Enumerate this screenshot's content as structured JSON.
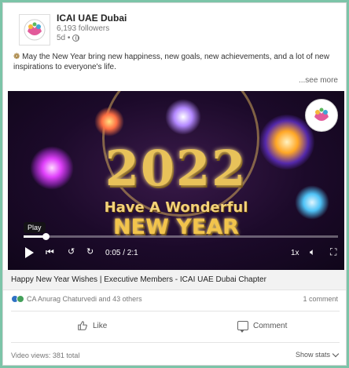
{
  "header": {
    "org_name": "ICAI UAE Dubai",
    "followers": "6,193 followers",
    "time": "5d •"
  },
  "post": {
    "sparkle": "❁",
    "text": "May the New Year bring new happiness, new goals, new achievements, and a lot of new inspirations to everyone's life.",
    "see_more": "...see more"
  },
  "video": {
    "year": "2022",
    "greeting_line1": "Have A Wonderful",
    "greeting_line2": "NEW YEAR",
    "tooltip": "Play",
    "progress": 0.07,
    "time": "0:05 / 2:1",
    "speed": "1x",
    "controls": {
      "play_icon": "play-icon",
      "rewind_icon": "skip-back-icon",
      "back_icon": "replay-10-icon",
      "forward_icon": "forward-10-icon",
      "volume_icon": "volume-icon",
      "fullscreen_icon": "fullscreen-icon"
    }
  },
  "caption": "Happy New Year Wishes | Executive Members - ICAI UAE Dubai Chapter",
  "reactions": {
    "text": "CA Anurag Chaturvedi and 43 others",
    "comments": "1 comment"
  },
  "actions": {
    "like": "Like",
    "comment": "Comment"
  },
  "footer": {
    "views": "Video views: 381 total",
    "show_stats": "Show stats"
  },
  "colors": {
    "page_bg": "#7cc4a8",
    "like_blue": "#2f72c4",
    "celebrate_green": "#44a05a",
    "gold": "#e8c25a"
  }
}
